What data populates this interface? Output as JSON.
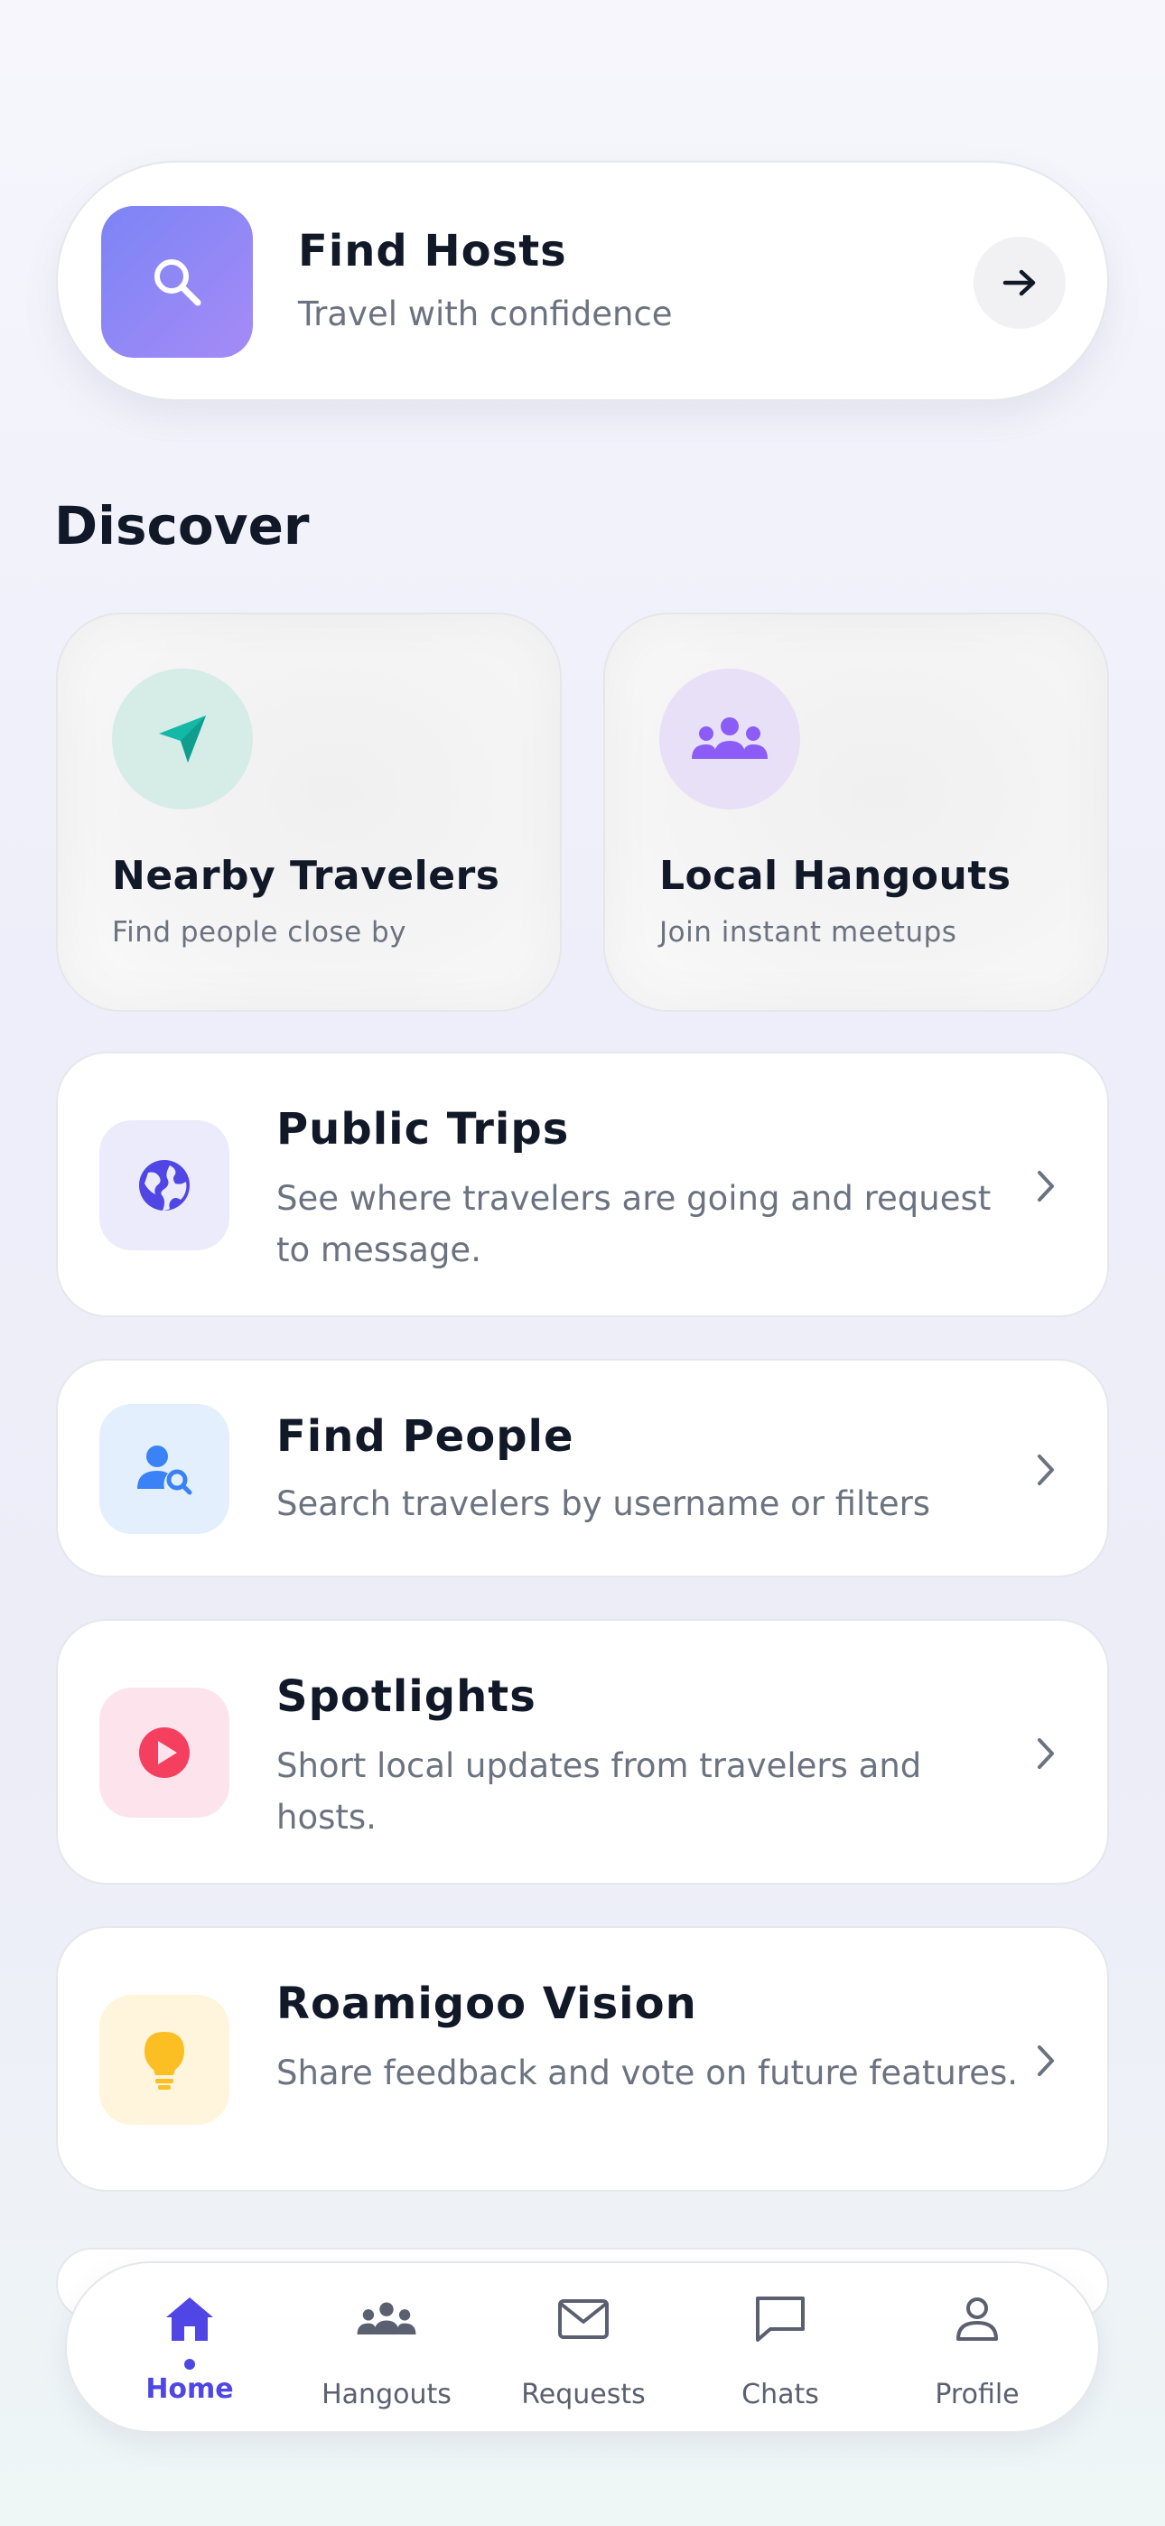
{
  "hero": {
    "title": "Find Hosts",
    "subtitle": "Travel with confidence",
    "icon": "search-icon",
    "action_icon": "arrow-right-icon"
  },
  "discover": {
    "title": "Discover",
    "tiles": [
      {
        "title": "Nearby Travelers",
        "subtitle": "Find people close by",
        "icon": "navigation-arrow-icon",
        "color": "#14b8a6"
      },
      {
        "title": "Local Hangouts",
        "subtitle": "Join instant meetups",
        "icon": "group-icon",
        "color": "#8b5cf6"
      }
    ]
  },
  "cards": [
    {
      "title": "Public Trips",
      "description": "See where travelers are going and request to message.",
      "icon": "globe-icon",
      "color": "#4f46e5"
    },
    {
      "title": "Find People",
      "description": "Search travelers by username or filters",
      "icon": "user-search-icon",
      "color": "#3b82f6"
    },
    {
      "title": "Spotlights",
      "description": "Short local updates from travelers and hosts.",
      "icon": "play-icon",
      "color": "#f43f5e"
    },
    {
      "title": "Roamigoo Vision",
      "description": "Share feedback and vote on future features.",
      "icon": "lightbulb-icon",
      "color": "#fbbf24"
    }
  ],
  "nav": {
    "active": "Home",
    "items": [
      {
        "label": "Home",
        "icon": "home-icon"
      },
      {
        "label": "Hangouts",
        "icon": "group-icon"
      },
      {
        "label": "Requests",
        "icon": "mail-icon"
      },
      {
        "label": "Chats",
        "icon": "chat-icon"
      },
      {
        "label": "Profile",
        "icon": "user-icon"
      }
    ]
  },
  "colors": {
    "accent": "#4f46e5",
    "text": "#111827",
    "muted": "#6b7280"
  }
}
